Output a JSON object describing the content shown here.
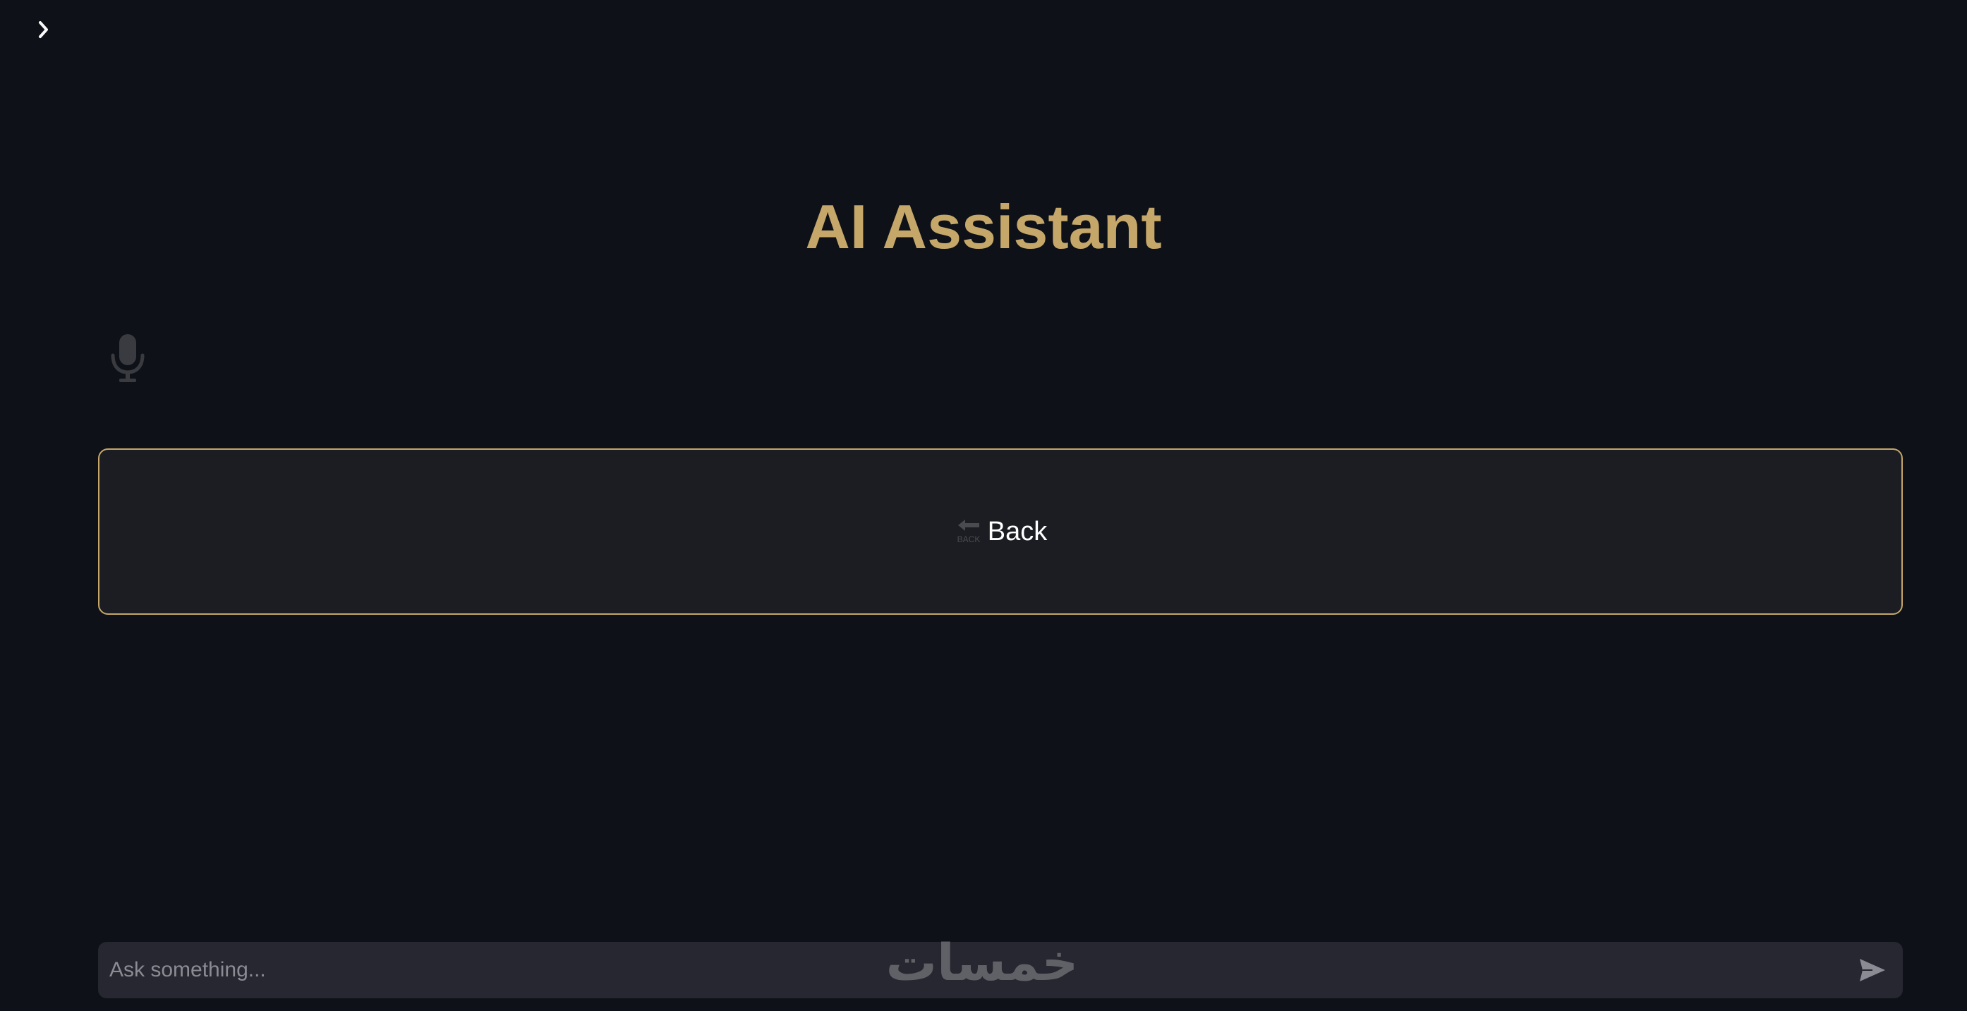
{
  "header": {
    "sidebar_toggle_icon": "chevron-right-icon"
  },
  "main": {
    "title": "AI Assistant",
    "title_color": "#c5a76a",
    "mic_icon": "microphone-icon",
    "back_button": {
      "label": "Back",
      "icon": "back-arrow-icon",
      "icon_text": "BACK",
      "border_color": "#c5a76a"
    }
  },
  "chat": {
    "placeholder": "Ask something...",
    "value": "",
    "send_icon": "send-icon"
  },
  "watermark": {
    "text": "خمسات"
  },
  "colors": {
    "background": "#0e1117",
    "button_background": "#1b1d22",
    "input_background": "#262730",
    "accent": "#c5a76a"
  }
}
